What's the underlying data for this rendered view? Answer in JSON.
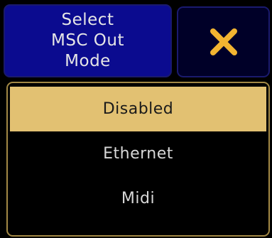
{
  "dialog": {
    "title_lines": [
      "Select",
      "MSC Out",
      "Mode"
    ],
    "close_icon": "close-x-icon",
    "options": [
      {
        "label": "Disabled",
        "selected": true
      },
      {
        "label": "Ethernet",
        "selected": false
      },
      {
        "label": "Midi",
        "selected": false
      }
    ]
  },
  "colors": {
    "background": "#000000",
    "title_box_fill": "#0b0b8f",
    "box_border": "#1a1a6e",
    "close_button_fill": "#000028",
    "close_icon": "#f2b431",
    "list_border": "#a28845",
    "selected_fill": "#e2c172",
    "selected_text": "#1a1a1a",
    "option_text": "#d8d8d8",
    "title_text": "#e6e6e6"
  }
}
